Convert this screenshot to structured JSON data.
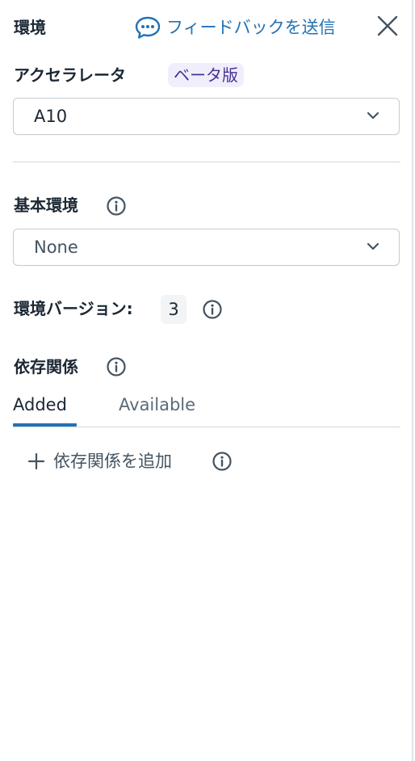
{
  "panel": {
    "title": "環境",
    "feedback_label": "フィードバックを送信",
    "icons": {
      "feedback": "chat-bubble-icon",
      "close": "close-icon"
    }
  },
  "accelerator": {
    "label": "アクセラレータ",
    "badge": "ベータ版",
    "value": "A10"
  },
  "base_environment": {
    "label": "基本環境",
    "value": "None"
  },
  "environment_version": {
    "label": "環境バージョン:",
    "value": "3"
  },
  "dependencies": {
    "label": "依存関係",
    "tabs": [
      {
        "label": "Added",
        "active": true
      },
      {
        "label": "Available",
        "active": false
      }
    ],
    "add_label": "依存関係を追加"
  },
  "colors": {
    "accent": "#2272b4",
    "text": "#1b2733",
    "muted_text": "#5a6b78",
    "border": "#c4ccd4",
    "badge_bg": "#f1eefc",
    "badge_text": "#463293"
  }
}
